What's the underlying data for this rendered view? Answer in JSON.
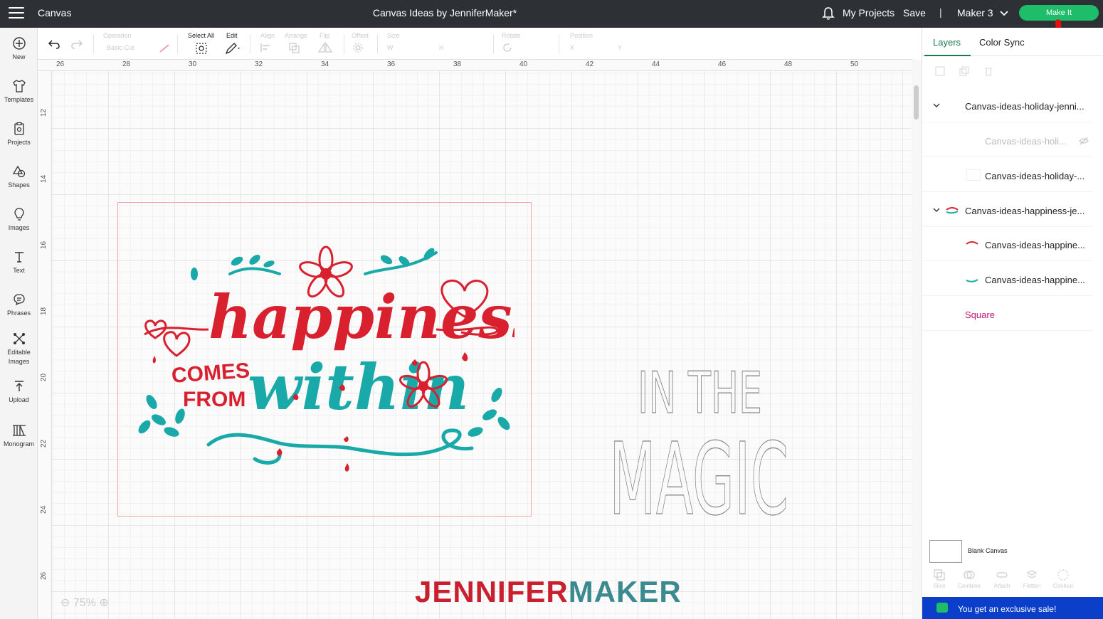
{
  "topbar": {
    "app_title": "Canvas",
    "doc_title": "Canvas Ideas by JenniferMaker*",
    "my_projects": "My Projects",
    "save": "Save",
    "separator": "|",
    "machine": "Maker 3",
    "make_it": "Make It"
  },
  "leftbar": {
    "items": [
      {
        "label": "New",
        "icon": "plus-circle-icon"
      },
      {
        "label": "Templates",
        "icon": "tshirt-icon"
      },
      {
        "label": "Projects",
        "icon": "clipboard-icon"
      },
      {
        "label": "Shapes",
        "icon": "shapes-icon"
      },
      {
        "label": "Images",
        "icon": "lightbulb-icon"
      },
      {
        "label": "Text",
        "icon": "text-icon"
      },
      {
        "label": "Phrases",
        "icon": "speech-bubble-icon"
      },
      {
        "label": "Editable",
        "label2": "Images",
        "icon": "editable-images-icon"
      },
      {
        "label": "Upload",
        "icon": "upload-icon"
      },
      {
        "label": "Monogram",
        "icon": "monogram-icon"
      }
    ]
  },
  "toolbar": {
    "operation": "Operation",
    "basic_cut": "Basic Cut",
    "select_all": "Select All",
    "edit": "Edit",
    "align": "Align",
    "arrange": "Arrange",
    "flip": "Flip",
    "offset": "Offset",
    "size": "Size",
    "w": "W",
    "h": "H",
    "rotate": "Rotate",
    "position": "Position",
    "x": "X",
    "y": "Y"
  },
  "ruler": {
    "top": [
      "26",
      "28",
      "30",
      "32",
      "34",
      "36",
      "38",
      "40",
      "42",
      "44",
      "46",
      "48",
      "50"
    ],
    "left": [
      "12",
      "14",
      "16",
      "18",
      "20",
      "22",
      "24",
      "26"
    ]
  },
  "canvas": {
    "zoom": "75%",
    "magic_line1": "IN THE",
    "magic_line2": "MAGIC",
    "logo_part1": "JENNIFER",
    "logo_part2": "MAKER",
    "art": {
      "word1": "happiness",
      "word2a": "COMES",
      "word2b": "FROM",
      "word3": "within"
    }
  },
  "panel": {
    "tabs": [
      "Layers",
      "Color Sync"
    ],
    "layers": [
      {
        "name": "Canvas-ideas-holiday-jenni...",
        "indent": 0,
        "expanded": true
      },
      {
        "name": "Canvas-ideas-holi...",
        "indent": 1,
        "hidden": true
      },
      {
        "name": "Canvas-ideas-holiday-...",
        "indent": 1
      },
      {
        "name": "Canvas-ideas-happiness-je...",
        "indent": 0,
        "expanded": true
      },
      {
        "name": "Canvas-ideas-happine...",
        "indent": 1
      },
      {
        "name": "Canvas-ideas-happine...",
        "indent": 1
      },
      {
        "name": "Square",
        "indent": 1,
        "color": "#c2187a"
      }
    ],
    "blank_canvas": "Blank Canvas",
    "bottom_tools": [
      "Slice",
      "Combine",
      "Attach",
      "Flatten",
      "Contour"
    ],
    "sale": "You get an exclusive sale!"
  },
  "colors": {
    "red": "#d8202e",
    "teal": "#19a9a8",
    "green": "#1dbd6a",
    "logo_red": "#c8202f",
    "logo_teal": "#3b8a8f"
  }
}
